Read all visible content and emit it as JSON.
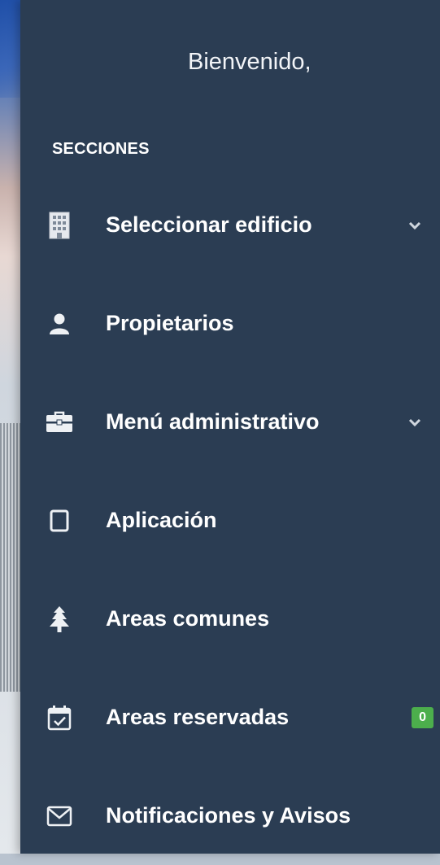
{
  "sidebar": {
    "welcome": "Bienvenido,",
    "section_title": "SECCIONES",
    "items": [
      {
        "label": "Seleccionar edificio",
        "icon": "building-icon",
        "expandable": true
      },
      {
        "label": "Propietarios",
        "icon": "user-icon",
        "expandable": false
      },
      {
        "label": "Menú administrativo",
        "icon": "briefcase-icon",
        "expandable": true
      },
      {
        "label": "Aplicación",
        "icon": "square-icon",
        "expandable": false
      },
      {
        "label": "Areas comunes",
        "icon": "tree-icon",
        "expandable": false
      },
      {
        "label": "Areas reservadas",
        "icon": "calendar-check-icon",
        "expandable": false,
        "badge": "0"
      },
      {
        "label": "Notificaciones y Avisos",
        "icon": "envelope-icon",
        "expandable": false
      }
    ]
  },
  "colors": {
    "sidebar_bg": "#2b3d53",
    "badge_bg": "#4cae4c",
    "text": "#ffffff"
  }
}
